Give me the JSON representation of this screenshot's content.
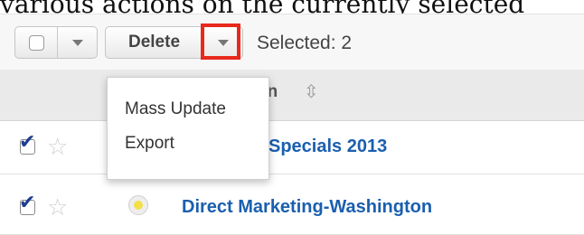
{
  "caption": "various actions on the currently selected",
  "toolbar": {
    "delete_label": "Delete",
    "selected_text": "Selected: 2"
  },
  "list_header": {
    "name_fragment": "gn",
    "sort_icon": "sort-icon"
  },
  "rows": [
    {
      "checked": true,
      "favorite": false,
      "name_visible": "Specials 2013"
    },
    {
      "checked": true,
      "favorite": false,
      "name": "Direct Marketing-Washington"
    }
  ],
  "dropdown": {
    "items": [
      {
        "label": "Mass Update"
      },
      {
        "label": "Export"
      }
    ]
  },
  "colors": {
    "highlight": "#e8291c",
    "link": "#1a5fae",
    "checkmark": "#1f3e8f"
  }
}
